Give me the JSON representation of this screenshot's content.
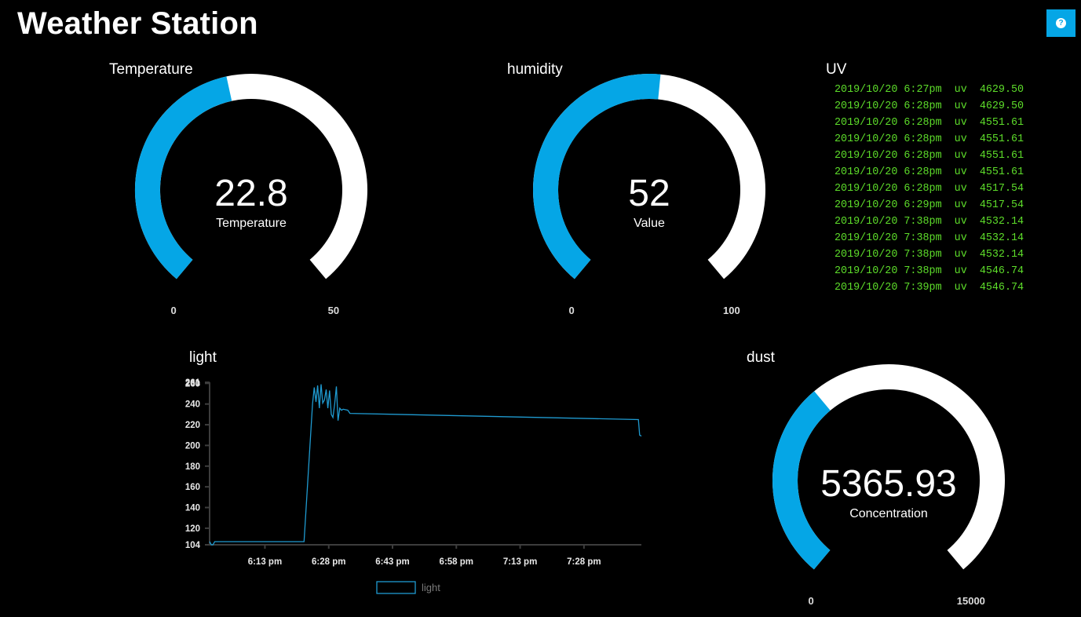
{
  "app": {
    "title": "Weather Station",
    "help_icon": "question-icon",
    "help_glyph": "?"
  },
  "colors": {
    "accent": "#05a6e6",
    "track": "#ffffff",
    "log_text": "#5ddc2a",
    "background": "#000000"
  },
  "widgets": {
    "temperature": {
      "title": "Temperature",
      "value": 22.8,
      "value_text": "22.8",
      "label": "Temperature",
      "min": 0,
      "max": 50,
      "min_text": "0",
      "max_text": "50"
    },
    "humidity": {
      "title": "humidity",
      "value": 52,
      "value_text": "52",
      "label": "Value",
      "min": 0,
      "max": 100,
      "min_text": "0",
      "max_text": "100"
    },
    "dust": {
      "title": "dust",
      "value": 5365.93,
      "value_text": "5365.93",
      "label": "Concentration",
      "min": 0,
      "max": 15000,
      "min_text": "0",
      "max_text": "15000"
    },
    "uv": {
      "title": "UV",
      "lines": [
        "2019/10/20 6:27pm  uv  4629.50",
        "2019/10/20 6:28pm  uv  4629.50",
        "2019/10/20 6:28pm  uv  4551.61",
        "2019/10/20 6:28pm  uv  4551.61",
        "2019/10/20 6:28pm  uv  4551.61",
        "2019/10/20 6:28pm  uv  4551.61",
        "2019/10/20 6:28pm  uv  4517.54",
        "2019/10/20 6:29pm  uv  4517.54",
        "2019/10/20 7:38pm  uv  4532.14",
        "2019/10/20 7:38pm  uv  4532.14",
        "2019/10/20 7:38pm  uv  4532.14",
        "2019/10/20 7:38pm  uv  4546.74",
        "2019/10/20 7:39pm  uv  4546.74"
      ]
    },
    "light": {
      "title": "light"
    }
  },
  "chart_data": {
    "type": "line",
    "title": "light",
    "xlabel": "",
    "ylabel": "",
    "x_ticks": [
      "6:13 pm",
      "6:28 pm",
      "6:43 pm",
      "6:58 pm",
      "7:13 pm",
      "7:28 pm"
    ],
    "x_tick_minutes": [
      13,
      28,
      43,
      58,
      73,
      88
    ],
    "xlim_minutes": [
      0,
      101.5
    ],
    "y_ticks": [
      104,
      120,
      140,
      160,
      180,
      200,
      220,
      240,
      260
    ],
    "y_top_label": "261",
    "ylim": [
      104,
      261
    ],
    "legend": {
      "position": "bottom",
      "entries": [
        "light"
      ]
    },
    "grid": false,
    "series": [
      {
        "name": "light",
        "color": "#1f9ad0",
        "points": [
          [
            0,
            107
          ],
          [
            0.4,
            104
          ],
          [
            0.8,
            104
          ],
          [
            1.2,
            107
          ],
          [
            22.2,
            107
          ],
          [
            24.2,
            240
          ],
          [
            24.6,
            256
          ],
          [
            25,
            242
          ],
          [
            25.4,
            258
          ],
          [
            25.8,
            236
          ],
          [
            26.2,
            259
          ],
          [
            26.6,
            241
          ],
          [
            27,
            244
          ],
          [
            27.4,
            254
          ],
          [
            27.8,
            236
          ],
          [
            28.2,
            253
          ],
          [
            28.6,
            230
          ],
          [
            29,
            227
          ],
          [
            29.4,
            240
          ],
          [
            29.8,
            257
          ],
          [
            30.2,
            224
          ],
          [
            30.6,
            236
          ],
          [
            31,
            234
          ],
          [
            31.4,
            235
          ],
          [
            32.5,
            234
          ],
          [
            33,
            231
          ],
          [
            100.8,
            225
          ],
          [
            101.1,
            210
          ],
          [
            101.5,
            209
          ]
        ]
      }
    ]
  }
}
